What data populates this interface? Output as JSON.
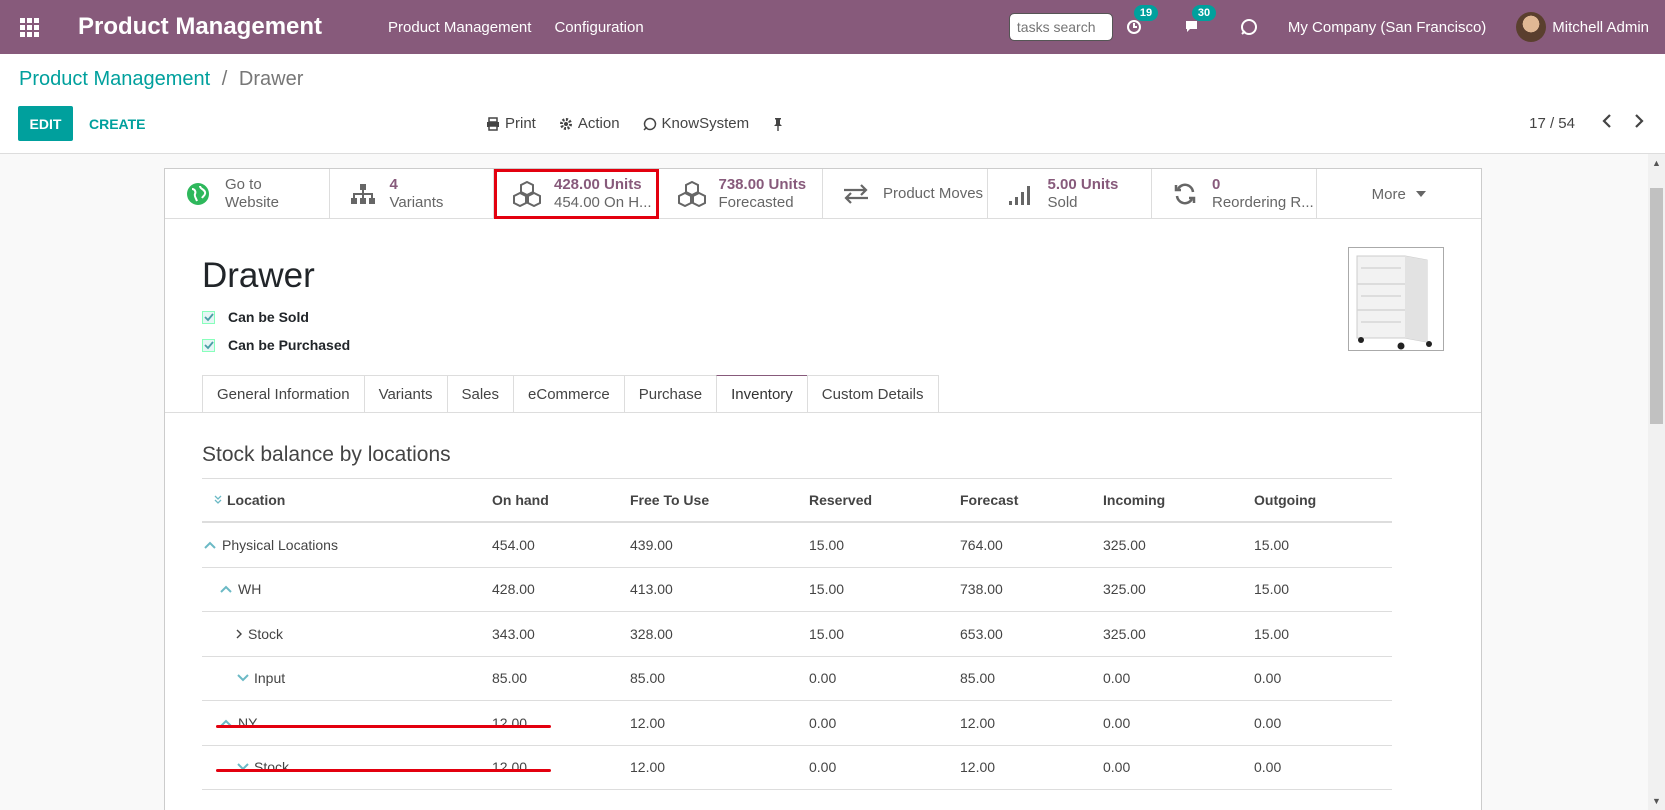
{
  "navbar": {
    "app_title": "Product Management",
    "menus": [
      "Product Management",
      "Configuration"
    ],
    "search_placeholder": "tasks search",
    "activity_count": "19",
    "messages_count": "30",
    "company": "My Company (San Francisco)",
    "user": "Mitchell Admin",
    "accent_color": "#875a7b"
  },
  "breadcrumb": {
    "parent": "Product Management",
    "separator": "/",
    "current": "Drawer"
  },
  "toolbar": {
    "edit_label": "EDIT",
    "create_label": "CREATE",
    "print_label": "Print",
    "action_label": "Action",
    "knowsystem_label": "KnowSystem",
    "pager": "17 / 54"
  },
  "stat_buttons": [
    {
      "value": "Go to",
      "label": "Website",
      "icon": "globe-icon"
    },
    {
      "value": "4",
      "label": "Variants",
      "icon": "sitemap-icon"
    },
    {
      "value": "428.00 Units",
      "label": "454.00 On H...",
      "icon": "cubes-icon"
    },
    {
      "value": "738.00 Units",
      "label": "Forecasted",
      "icon": "cubes-icon"
    },
    {
      "value": "",
      "label": "Product Moves",
      "icon": "exchange-icon"
    },
    {
      "value": "5.00 Units",
      "label": "Sold",
      "icon": "signal-icon"
    },
    {
      "value": "0",
      "label": "Reordering R...",
      "icon": "refresh-icon"
    },
    {
      "value": "",
      "label": "More",
      "icon": "caret-down-icon"
    }
  ],
  "product": {
    "name": "Drawer",
    "can_be_sold_label": "Can be Sold",
    "can_be_purchased_label": "Can be Purchased"
  },
  "tabs": [
    "General Information",
    "Variants",
    "Sales",
    "eCommerce",
    "Purchase",
    "Inventory",
    "Custom Details"
  ],
  "active_tab": "Inventory",
  "stock": {
    "title": "Stock balance by locations",
    "columns": [
      "Location",
      "On hand",
      "Free To Use",
      "Reserved",
      "Forecast",
      "Incoming",
      "Outgoing"
    ],
    "rows": [
      {
        "name": "Physical Locations",
        "on_hand": "454.00",
        "free": "439.00",
        "reserved": "15.00",
        "forecast": "764.00",
        "incoming": "325.00",
        "outgoing": "15.00"
      },
      {
        "name": "WH",
        "on_hand": "428.00",
        "free": "413.00",
        "reserved": "15.00",
        "forecast": "738.00",
        "incoming": "325.00",
        "outgoing": "15.00"
      },
      {
        "name": "Stock",
        "on_hand": "343.00",
        "free": "328.00",
        "reserved": "15.00",
        "forecast": "653.00",
        "incoming": "325.00",
        "outgoing": "15.00"
      },
      {
        "name": "Input",
        "on_hand": "85.00",
        "free": "85.00",
        "reserved": "0.00",
        "forecast": "85.00",
        "incoming": "0.00",
        "outgoing": "0.00"
      },
      {
        "name": "NY",
        "on_hand": "12.00",
        "free": "12.00",
        "reserved": "0.00",
        "forecast": "12.00",
        "incoming": "0.00",
        "outgoing": "0.00"
      },
      {
        "name": "Stock",
        "on_hand": "12.00",
        "free": "12.00",
        "reserved": "0.00",
        "forecast": "12.00",
        "incoming": "0.00",
        "outgoing": "0.00"
      }
    ]
  }
}
